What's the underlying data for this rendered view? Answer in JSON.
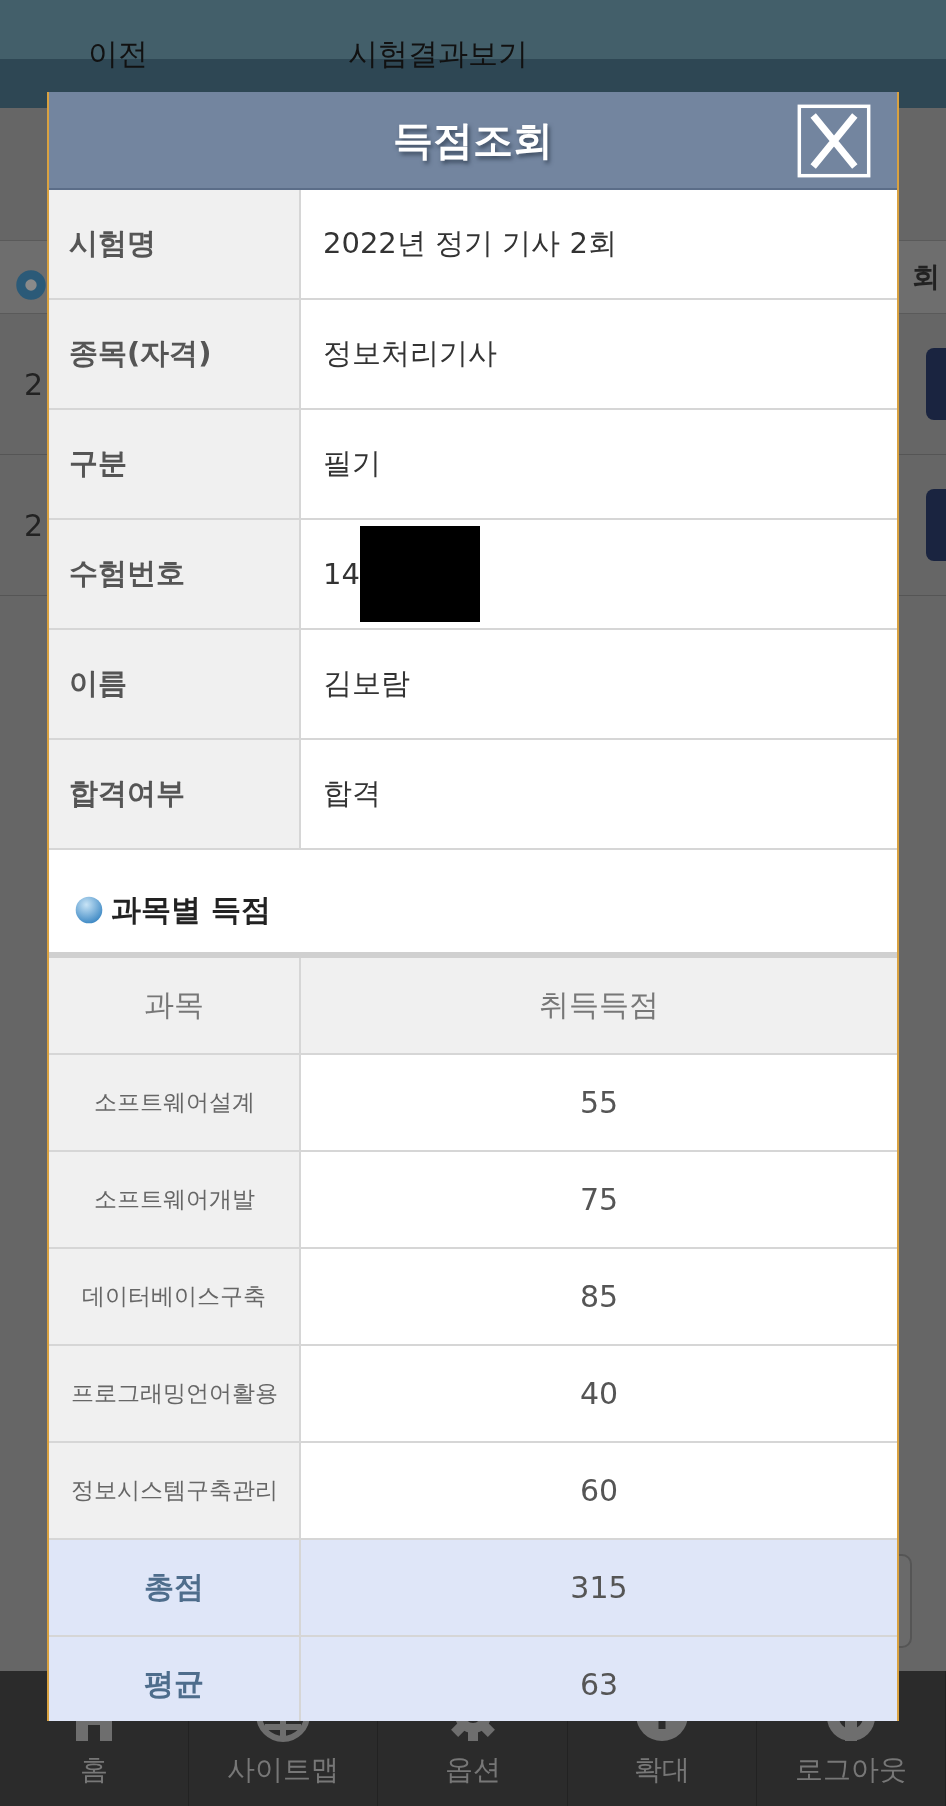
{
  "background_page": {
    "header": {
      "back_link": "이전",
      "title": "시험결과보기"
    },
    "table": {
      "header_fragment": "회",
      "rows": [
        {
          "cell_fragment": "2"
        },
        {
          "cell_fragment": "2"
        }
      ]
    },
    "bottom_nav": [
      {
        "kind": "home",
        "label": "홈"
      },
      {
        "kind": "globe",
        "label": "사이트맵"
      },
      {
        "kind": "gear",
        "label": "옵션"
      },
      {
        "kind": "plus",
        "label": "확대"
      },
      {
        "kind": "power",
        "label": "로그아웃"
      }
    ]
  },
  "dialog": {
    "title": "득점조회",
    "info": [
      {
        "label": "시험명",
        "value": "2022년 정기 기사 2회",
        "redacted": false
      },
      {
        "label": "종목(자격)",
        "value": "정보처리기사",
        "redacted": false
      },
      {
        "label": "구분",
        "value": "필기",
        "redacted": false
      },
      {
        "label": "수험번호",
        "value": "14",
        "redacted": true
      },
      {
        "label": "이름",
        "value": "김보람",
        "redacted": false
      },
      {
        "label": "합격여부",
        "value": "합격",
        "redacted": false
      }
    ],
    "section_title": "과목별 득점",
    "scores": {
      "columns": [
        "과목",
        "취득득점"
      ],
      "rows": [
        {
          "subject": "소프트웨어설계",
          "score": "55"
        },
        {
          "subject": "소프트웨어개발",
          "score": "75"
        },
        {
          "subject": "데이터베이스구축",
          "score": "85"
        },
        {
          "subject": "프로그래밍언어활용",
          "score": "40"
        },
        {
          "subject": "정보시스템구축관리",
          "score": "60"
        }
      ],
      "summary": [
        {
          "label": "총점",
          "value": "315"
        },
        {
          "label": "평균",
          "value": "63"
        }
      ]
    }
  }
}
